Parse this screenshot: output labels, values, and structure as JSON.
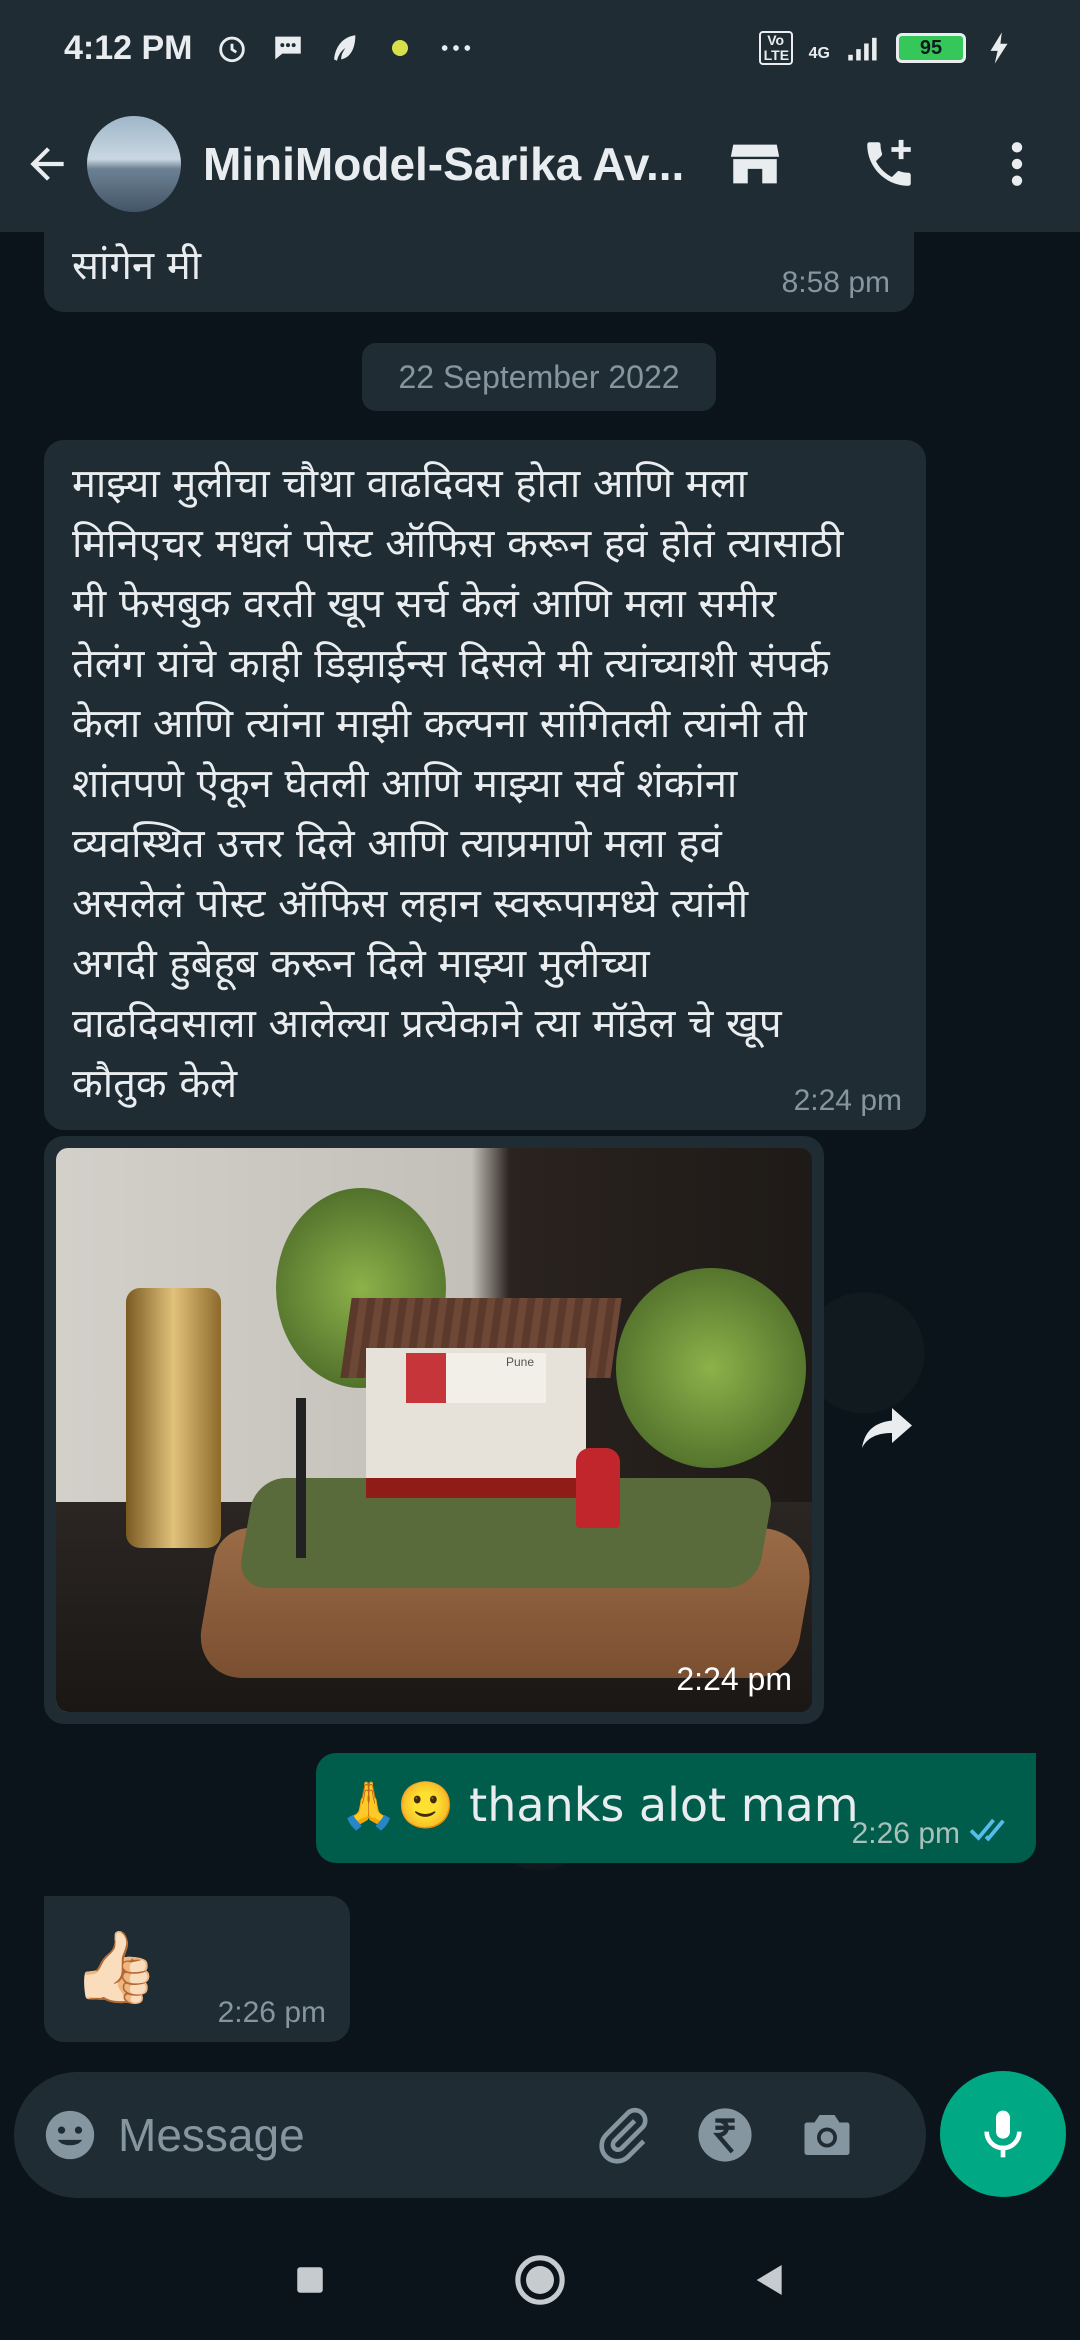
{
  "status_bar": {
    "time": "4:12 PM",
    "network": "4G",
    "volte": "Vo LTE",
    "battery": "95",
    "icons": [
      "alarm-icon",
      "message-icon",
      "feather-icon",
      "dot-icon",
      "more-dots-icon"
    ]
  },
  "header": {
    "contact_name": "MiniModel-Sarika Av...",
    "icons": [
      "back-arrow-icon",
      "store-icon",
      "add-call-icon",
      "menu-dots-icon"
    ]
  },
  "messages": [
    {
      "type": "incoming",
      "text": "सांगेन मी",
      "time": "8:58 pm"
    },
    {
      "type": "date",
      "text": "22 September 2022"
    },
    {
      "type": "incoming",
      "lines": [
        "माझ्या मुलीचा चौथा वाढदिवस होता आणि मला",
        "मिनिएचर मधलं पोस्ट ऑफिस करून हवं होतं त्यासाठी",
        "मी फेसबुक वरती खूप सर्च केलं आणि मला समीर",
        "तेलंग यांचे काही डिझाईन्स दिसले मी त्यांच्याशी संपर्क",
        "केला आणि त्यांना माझी कल्पना सांगितली त्यांनी ती",
        "शांतपणे ऐकून घेतली आणि माझ्या सर्व शंकांना",
        "व्यवस्थित उत्तर दिले आणि त्याप्रमाणे मला हवं",
        "असलेलं पोस्ट ऑफिस लहान स्वरूपामध्ये त्यांनी",
        "अगदी हुबेहूब करून दिले माझ्या मुलीच्या",
        "वाढदिवसाला आलेल्या प्रत्येकाने त्या मॉडेल चे खूप",
        "कौतुक केले"
      ],
      "time": "2:24 pm"
    },
    {
      "type": "incoming-image",
      "sign_text": "Pune",
      "time": "2:24 pm"
    },
    {
      "type": "outgoing",
      "text": "🙏🙂 thanks alot mam",
      "time": "2:26 pm",
      "status": "read"
    },
    {
      "type": "incoming",
      "text": "👍🏻",
      "time": "2:26 pm"
    }
  ],
  "input": {
    "placeholder": "Message",
    "icons": [
      "emoji-icon",
      "attach-icon",
      "rupee-payment-icon",
      "camera-icon",
      "mic-icon"
    ]
  },
  "nav": {
    "icons": [
      "recents-square-icon",
      "home-circle-icon",
      "back-triangle-icon"
    ]
  },
  "colors": {
    "background": "#0b141a",
    "bar": "#1f2c34",
    "incoming_bubble": "#1f2c34",
    "outgoing_bubble": "#005c4b",
    "accent": "#00a884",
    "tick": "#53bdeb"
  }
}
